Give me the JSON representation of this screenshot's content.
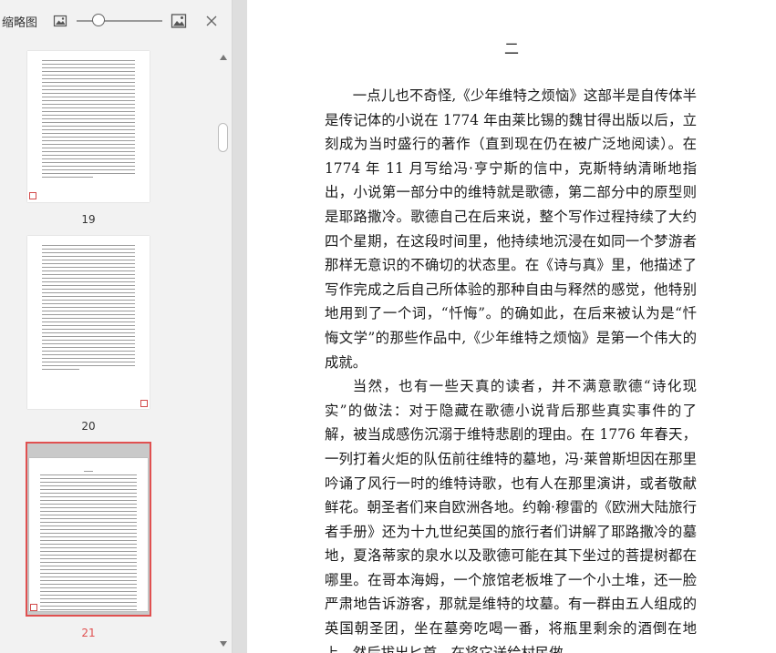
{
  "sidebar": {
    "title": "缩略图",
    "icons": {
      "zoom_out": "image-small-icon",
      "zoom_in": "image-large-icon",
      "close": "close-icon"
    },
    "zoom_level": 0.27,
    "thumbnails": [
      {
        "page": "19",
        "selected": false
      },
      {
        "page": "20",
        "selected": false
      },
      {
        "page": "21",
        "selected": true
      }
    ],
    "accent_color": "#e05050"
  },
  "document": {
    "heading": "二",
    "paragraphs": [
      "一点儿也不奇怪,《少年维特之烦恼》这部半是自传体半是传记体的小说在 1774 年由莱比锡的魏甘得出版以后，立刻成为当时盛行的著作（直到现在仍在被广泛地阅读）。在 1774 年 11 月写给冯·亨宁斯的信中，克斯特纳清晰地指出，小说第一部分中的维特就是歌德，第二部分中的原型则是耶路撒冷。歌德自己在后来说，整个写作过程持续了大约四个星期，在这段时间里，他持续地沉浸在如同一个梦游者那样无意识的不确切的状态里。在《诗与真》里，他描述了写作完成之后自己所体验的那种自由与释然的感觉，他特别地用到了一个词，“忏悔”。的确如此，在后来被认为是“忏悔文学”的那些作品中,《少年维特之烦恼》是第一个伟大的成就。",
      "当然，也有一些天真的读者，并不满意歌德“诗化现实”的做法：对于隐藏在歌德小说背后那些真实事件的了解，被当成感伤沉溺于维特悲剧的理由。在 1776 年春天，一列打着火炬的队伍前往维特的墓地，冯·莱曾斯坦因在那里吟诵了风行一时的维特诗歌，也有人在那里演讲，或者敬献鲜花。朝圣者们来自欧洲各地。约翰·穆雷的《欧洲大陆旅行者手册》还为十九世纪英国的旅行者们讲解了耶路撒冷的墓地，夏洛蒂家的泉水以及歌德可能在其下坐过的菩提树都在哪里。在哥本海姆，一个旅馆老板堆了一个小土堆，还一脸严肃地告诉游客，那就是维特的坟墓。有一群由五人组成的英国朝圣团，坐在墓旁吃喝一番，将瓶里剩余的酒倒在地上，然后拔出匕首。在将它送给村民做"
    ]
  }
}
